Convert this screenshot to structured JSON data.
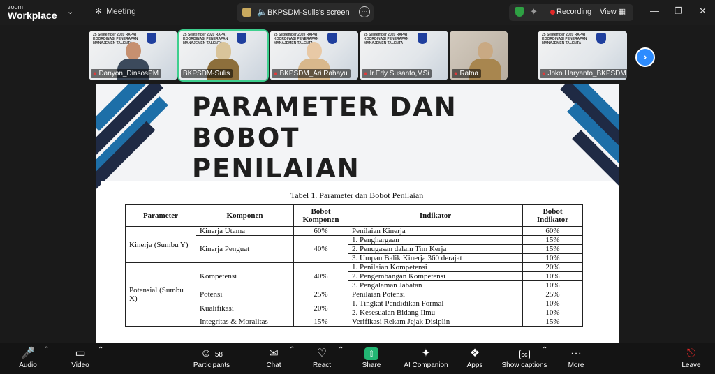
{
  "topbar": {
    "brand_small": "zoom",
    "brand_big": "Workplace",
    "meeting_label": "Meeting",
    "share_label": "BKPSDM-Sulis's screen",
    "recording_label": "Recording",
    "view_label": "View"
  },
  "gallery": {
    "slide_banner": "25 September 2020 RAPAT KOORDINASI PENERAPAN MANAJEMEN TALENTA",
    "participants": [
      {
        "name": "Danyon_DinsosPM"
      },
      {
        "name": "BKPSDM-Sulis"
      },
      {
        "name": "BKPSDM_Ari Rahayu"
      },
      {
        "name": "Ir.Edy Susanto,MSi"
      },
      {
        "name": "Ratna"
      },
      {
        "name": "Joko Haryanto_BKPSDM"
      }
    ]
  },
  "slide": {
    "title_line1": "PARAMETER DAN BOBOT",
    "title_line2": "PENILAIAN",
    "table_caption": "Tabel 1. Parameter dan Bobot Penilaian",
    "headers": {
      "parameter": "Parameter",
      "komponen": "Komponen",
      "bobot_komponen": "Bobot Komponen",
      "indikator": "Indikator",
      "bobot_indikator": "Bobot Indikator"
    },
    "rows": [
      {
        "parameter": "Kinerja (Sumbu Y)",
        "komponen": "Kinerja Utama",
        "bobot": "60%",
        "indikator": "Penilaian Kinerja",
        "bobot_ind": "60%"
      },
      {
        "komponen": "Kinerja Penguat",
        "bobot": "40%",
        "indikator": "1.  Penghargaan",
        "bobot_ind": "15%"
      },
      {
        "indikator": "2.  Penugasan dalam Tim Kerja",
        "bobot_ind": "15%"
      },
      {
        "indikator": "3.  Umpan Balik Kinerja 360 derajat",
        "bobot_ind": "10%"
      },
      {
        "parameter": "Potensial (Sumbu X)",
        "komponen": "Kompetensi",
        "bobot": "40%",
        "indikator": "1.  Penilaian Kompetensi",
        "bobot_ind": "20%"
      },
      {
        "indikator": "2.  Pengembangan Kompetensi",
        "bobot_ind": "10%"
      },
      {
        "indikator": "3.  Pengalaman Jabatan",
        "bobot_ind": "10%"
      },
      {
        "komponen": "Potensi",
        "bobot": "25%",
        "indikator": "Penilaian Potensi",
        "bobot_ind": "25%"
      },
      {
        "komponen": "Kualifikasi",
        "bobot": "20%",
        "indikator": "1.  Tingkat Pendidikan Formal",
        "bobot_ind": "10%"
      },
      {
        "indikator": "2.  Kesesuaian Bidang Ilmu",
        "bobot_ind": "10%"
      },
      {
        "komponen": "Integritas & Moralitas",
        "bobot": "15%",
        "indikator": "Verifikasi Rekam Jejak Disiplin",
        "bobot_ind": "15%"
      }
    ]
  },
  "toolbar": {
    "audio": "Audio",
    "video": "Video",
    "participants": "Participants",
    "participants_count": "58",
    "chat": "Chat",
    "react": "React",
    "share": "Share",
    "ai_companion": "AI Companion",
    "apps": "Apps",
    "captions": "Show captions",
    "more": "More",
    "leave": "Leave"
  },
  "colors": {
    "accent_blue": "#2d8cff",
    "share_green": "#22b573",
    "record_red": "#e02828",
    "slide_stripe": "#1d6fa8"
  }
}
